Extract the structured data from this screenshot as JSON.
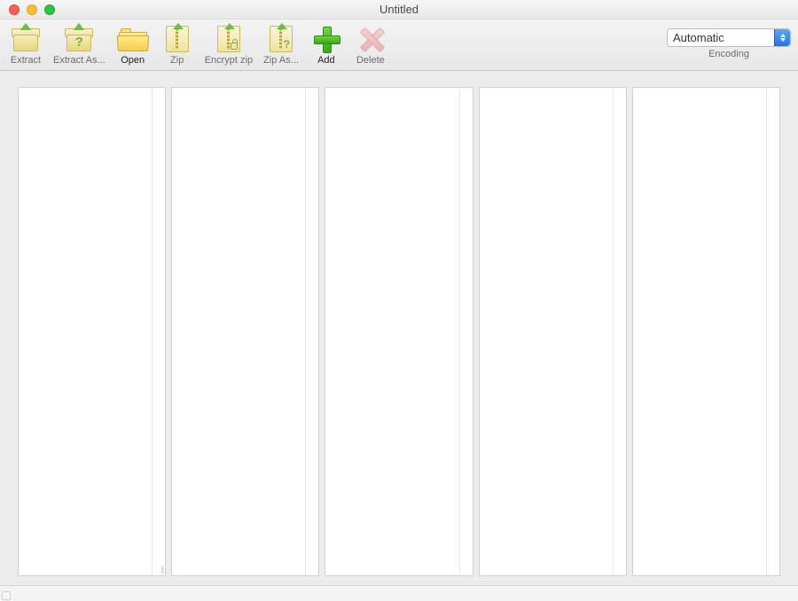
{
  "window": {
    "title": "Untitled"
  },
  "toolbar": {
    "extract": {
      "label": "Extract"
    },
    "extract_as": {
      "label": "Extract As..."
    },
    "open": {
      "label": "Open"
    },
    "zip": {
      "label": "Zip"
    },
    "encrypt_zip": {
      "label": "Encrypt zip"
    },
    "zip_as": {
      "label": "Zip As..."
    },
    "add": {
      "label": "Add"
    },
    "delete": {
      "label": "Delete"
    }
  },
  "encoding": {
    "selected": "Automatic",
    "caption": "Encoding"
  },
  "browser": {
    "column_count": 5
  },
  "statusbar": {
    "text": "."
  }
}
